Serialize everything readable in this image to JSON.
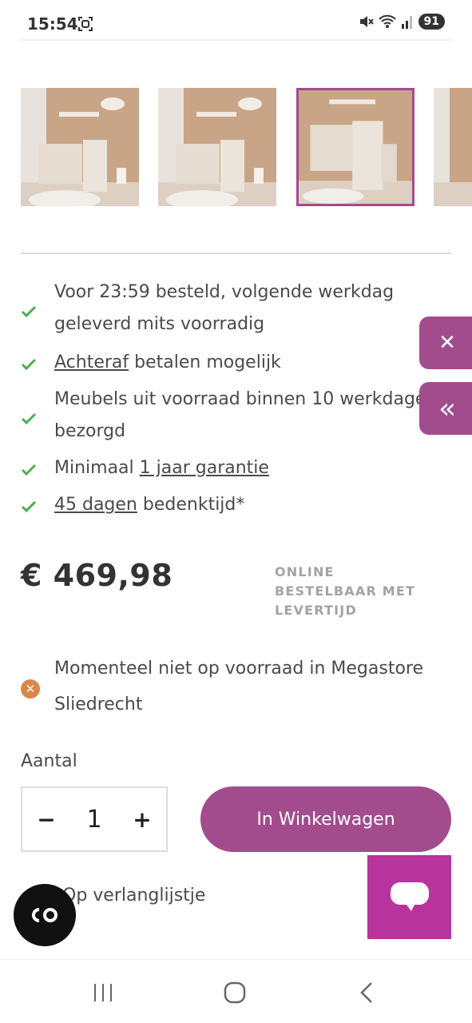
{
  "status_bar": {
    "time": "15:54",
    "battery": "91",
    "icons": [
      "screenshot-icon",
      "mute-icon",
      "wifi-icon",
      "signal-icon",
      "battery-icon"
    ]
  },
  "gallery": {
    "thumbnails": [
      {
        "label": "product-photo-1",
        "selected": false
      },
      {
        "label": "product-photo-2",
        "selected": false
      },
      {
        "label": "product-photo-3",
        "selected": true
      },
      {
        "label": "product-photo-4",
        "selected": false
      }
    ]
  },
  "usps": [
    {
      "lines": [
        "Voor 23:59 besteld, volgende werkdag",
        "geleverd mits voorradig"
      ]
    },
    {
      "link": "Achteraf",
      "rest": " betalen mogelijk"
    },
    {
      "lines": [
        "Meubels uit voorraad binnen 10 werkdagen",
        "bezorgd"
      ]
    },
    {
      "prefix": "Minimaal ",
      "link": "1 jaar garantie"
    },
    {
      "link": "45 dagen",
      "rest": " bedenktijd*"
    }
  ],
  "price": {
    "amount": "€ 469,98",
    "availability": [
      "ONLINE",
      "BESTELBAAR MET",
      "LEVERTIJD"
    ]
  },
  "stock": {
    "lines": [
      "Momenteel niet op voorraad in Megastore",
      "Sliedrecht"
    ],
    "icon": "close-circle-icon"
  },
  "quantity": {
    "label": "Aantal",
    "value": "1",
    "minus": "−",
    "plus": "+"
  },
  "cart_button": "In Winkelwagen",
  "wishlist": "Op verlanglijstje",
  "side_tabs": {
    "close": "✕",
    "expand": "«"
  },
  "co_badge": "CO",
  "colors": {
    "brand": "#a24c8d",
    "chat": "#b8349c",
    "check": "#4caf50",
    "stock_warning": "#d9874a"
  }
}
